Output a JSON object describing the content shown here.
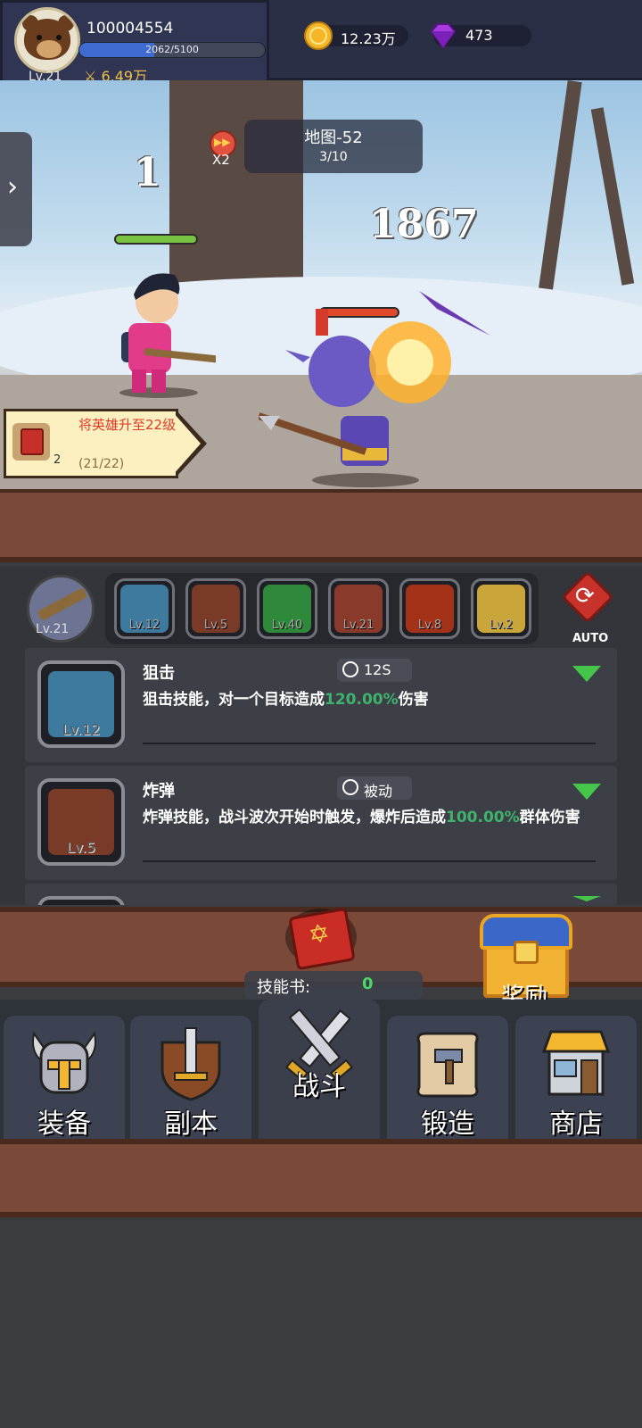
{
  "player": {
    "id": "100004554",
    "level": "Lv.21",
    "exp": "2062/5100",
    "exp_fraction": 0.404,
    "power": "6.49万"
  },
  "currency": {
    "gold": "12.23万",
    "gems": "473"
  },
  "battle": {
    "speed": "X2",
    "map_name": "地图-52",
    "wave": "3/10",
    "damage_numbers": [
      "1",
      "1867"
    ]
  },
  "quest": {
    "title": "将英雄升至22级",
    "progress": "(21/22)",
    "reward_count": "2"
  },
  "weapon": {
    "level": "Lv.21"
  },
  "skills": [
    {
      "level": "Lv.12",
      "icon": "sniper-skill-icon",
      "color": "#3d7a9e"
    },
    {
      "level": "Lv.5",
      "icon": "bomb-skill-icon",
      "color": "#7a3a28"
    },
    {
      "level": "Lv.40",
      "icon": "green-ghost-skill-icon",
      "color": "#2e8a3a"
    },
    {
      "level": "Lv.21",
      "icon": "pig-skill-icon",
      "color": "#8a3a2a"
    },
    {
      "level": "Lv.8",
      "icon": "fireball-skill-icon",
      "color": "#a43218"
    },
    {
      "level": "Lv.2",
      "icon": "lightning-skill-icon",
      "color": "#c9a53a"
    }
  ],
  "auto_label": "AUTO",
  "skill_cards": [
    {
      "name": "狙击",
      "cooldown": "12S",
      "level": "Lv.12",
      "desc_before": "狙击技能，对一个目标造成",
      "desc_highlight": "120.00%",
      "desc_after": "伤害"
    },
    {
      "name": "炸弹",
      "cooldown": "被动",
      "level": "Lv.5",
      "desc_before": "炸弹技能，战斗波次开始时触发，爆炸后造成",
      "desc_highlight": "100.00%",
      "desc_after": "群体伤害"
    }
  ],
  "skill_book": {
    "label": "技能书:",
    "count": "0"
  },
  "reward_label": "奖励",
  "nav": [
    {
      "label": "装备",
      "icon": "helmet-icon"
    },
    {
      "label": "副本",
      "icon": "sword-shield-icon"
    },
    {
      "label": "战斗",
      "icon": "crossed-swords-icon"
    },
    {
      "label": "锻造",
      "icon": "forge-scroll-icon"
    },
    {
      "label": "商店",
      "icon": "shop-icon"
    }
  ],
  "colors": {
    "exp_bar": "#3f6ad0",
    "highlight_green": "#3fb36e",
    "plank": "#7a4938",
    "quest_text": "#e23a26"
  }
}
